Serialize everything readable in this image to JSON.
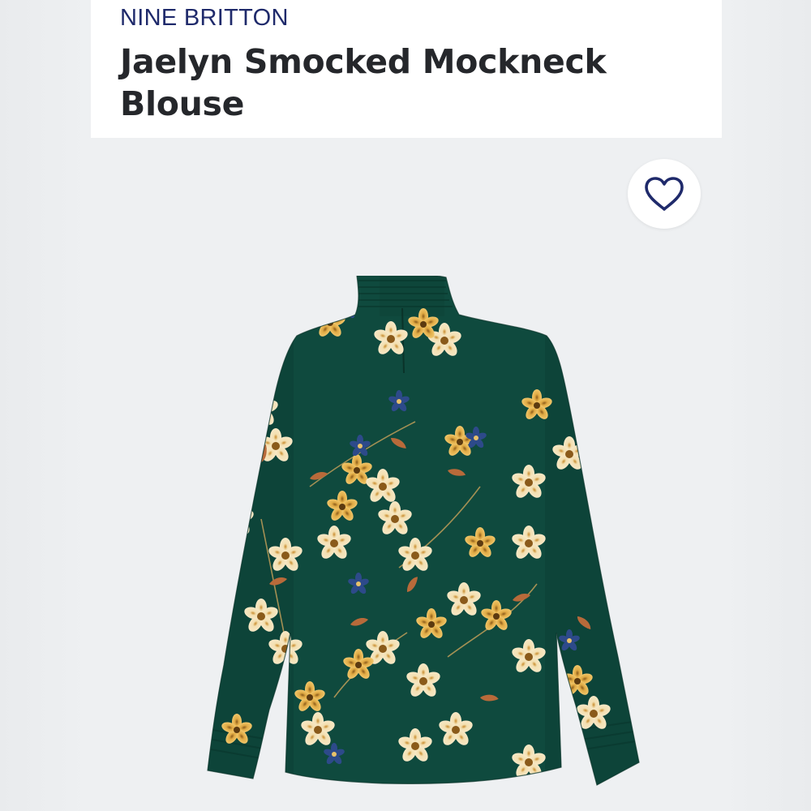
{
  "product": {
    "brand": "NINE BRITTON",
    "name": "Jaelyn Smocked Mockneck Blouse"
  },
  "colors": {
    "brand_text": "#1f2a6b",
    "title_text": "#25272b",
    "garment_base": "#0f4a3e",
    "flower_cream": "#f3dfb0",
    "flower_gold": "#d9a33a",
    "leaf_rust": "#b86a3a",
    "accent_navy": "#243a7a"
  },
  "icons": {
    "favorite": "heart-icon"
  }
}
